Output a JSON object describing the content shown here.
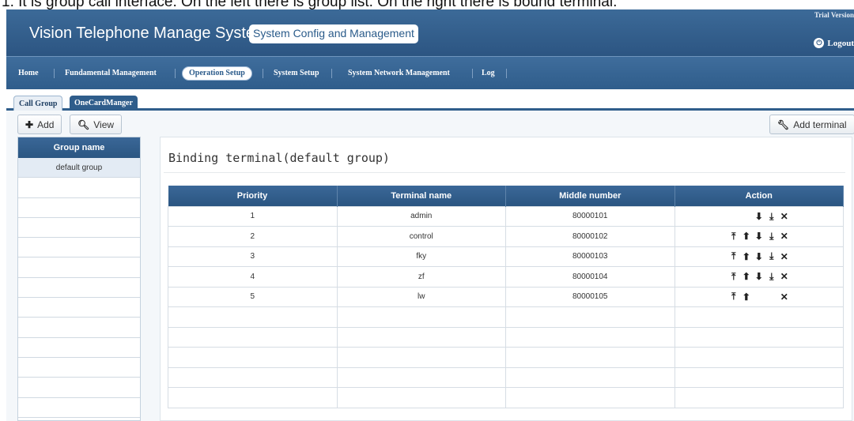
{
  "caption": "1. It is group call interface. On the left there is group list. On the right there is bound terminal.",
  "header": {
    "title": "Vision Telephone Manage System",
    "subtitle": "System Config and Management",
    "trial": "Trial Version",
    "logout": "Logout"
  },
  "nav": {
    "items": [
      {
        "label": "Home"
      },
      {
        "label": "Fundamental Management"
      },
      {
        "label": "Operation Setup"
      },
      {
        "label": "System Setup"
      },
      {
        "label": "System Network Management"
      },
      {
        "label": "Log"
      }
    ],
    "active": "Operation Setup"
  },
  "tabs": [
    {
      "label": "Call Group",
      "active": true
    },
    {
      "label": "OneCardManger",
      "active": false
    }
  ],
  "toolbar": {
    "add_label": "Add",
    "view_label": "View",
    "add_terminal_label": "Add terminal"
  },
  "group_list": {
    "header": "Group name",
    "items": [
      "default group"
    ],
    "selected": "default group"
  },
  "main": {
    "title": "Binding terminal(default group)",
    "columns": [
      "Priority",
      "Terminal name",
      "Middle number",
      "Action"
    ],
    "rows": [
      {
        "priority": "1",
        "name": "admin",
        "number": "80000101",
        "actions": [
          "down-icon",
          "bottom-icon",
          "delete-icon"
        ]
      },
      {
        "priority": "2",
        "name": "control",
        "number": "80000102",
        "actions": [
          "top-icon",
          "up-icon",
          "down-icon",
          "bottom-icon",
          "delete-icon"
        ]
      },
      {
        "priority": "3",
        "name": "fky",
        "number": "80000103",
        "actions": [
          "top-icon",
          "up-icon",
          "down-icon",
          "bottom-icon",
          "delete-icon"
        ]
      },
      {
        "priority": "4",
        "name": "zf",
        "number": "80000104",
        "actions": [
          "top-icon",
          "up-icon",
          "down-icon",
          "bottom-icon",
          "delete-icon"
        ]
      },
      {
        "priority": "5",
        "name": "lw",
        "number": "80000105",
        "actions": [
          "top-icon",
          "up-icon",
          "delete-icon"
        ]
      }
    ]
  },
  "colors": {
    "header_blue": "#2c5582",
    "nav_blue": "#2f5d8b",
    "table_header": "#2a5581"
  }
}
